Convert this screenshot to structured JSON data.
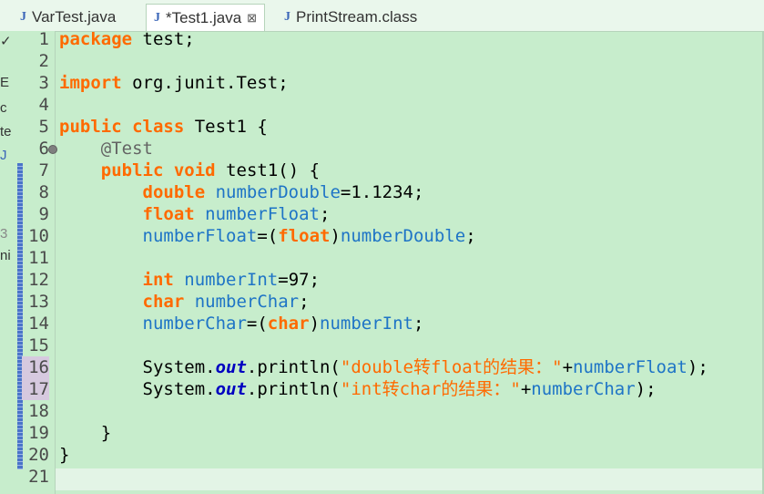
{
  "tabs": [
    {
      "label": "VarTest.java",
      "icon": "java-file-icon",
      "active": false
    },
    {
      "label": "*Test1.java",
      "icon": "java-file-icon",
      "active": true,
      "close": "⊠"
    },
    {
      "label": "PrintStream.class",
      "icon": "class-file-icon",
      "active": false
    }
  ],
  "left_strip": [
    "✓",
    "E",
    "c",
    "te",
    "J",
    "3",
    "ni"
  ],
  "editor": {
    "line_numbers": [
      "1",
      "2",
      "3",
      "4",
      "5",
      "6",
      "7",
      "8",
      "9",
      "10",
      "11",
      "12",
      "13",
      "14",
      "15",
      "16",
      "17",
      "18",
      "19",
      "20",
      "21"
    ],
    "lines": [
      [
        {
          "t": "package",
          "c": "kw"
        },
        {
          "t": " test;"
        }
      ],
      [],
      [
        {
          "t": "import",
          "c": "kw"
        },
        {
          "t": " org.junit.Test;"
        }
      ],
      [],
      [
        {
          "t": "public",
          "c": "kw"
        },
        {
          "t": " "
        },
        {
          "t": "class",
          "c": "kw"
        },
        {
          "t": " Test1 {"
        }
      ],
      [
        {
          "t": "    "
        },
        {
          "t": "@Test",
          "c": "ann"
        }
      ],
      [
        {
          "t": "    "
        },
        {
          "t": "public",
          "c": "kw"
        },
        {
          "t": " "
        },
        {
          "t": "void",
          "c": "kw"
        },
        {
          "t": " test1() {"
        }
      ],
      [
        {
          "t": "        "
        },
        {
          "t": "double",
          "c": "kw"
        },
        {
          "t": " "
        },
        {
          "t": "numberDouble",
          "c": "var"
        },
        {
          "t": "=1.1234;"
        }
      ],
      [
        {
          "t": "        "
        },
        {
          "t": "float",
          "c": "kw"
        },
        {
          "t": " "
        },
        {
          "t": "numberFloat",
          "c": "var"
        },
        {
          "t": ";"
        }
      ],
      [
        {
          "t": "        "
        },
        {
          "t": "numberFloat",
          "c": "var"
        },
        {
          "t": "=("
        },
        {
          "t": "float",
          "c": "kw"
        },
        {
          "t": ")"
        },
        {
          "t": "numberDouble",
          "c": "var"
        },
        {
          "t": ";"
        }
      ],
      [],
      [
        {
          "t": "        "
        },
        {
          "t": "int",
          "c": "kw"
        },
        {
          "t": " "
        },
        {
          "t": "numberInt",
          "c": "var"
        },
        {
          "t": "=97;"
        }
      ],
      [
        {
          "t": "        "
        },
        {
          "t": "char",
          "c": "kw"
        },
        {
          "t": " "
        },
        {
          "t": "numberChar",
          "c": "var"
        },
        {
          "t": ";"
        }
      ],
      [
        {
          "t": "        "
        },
        {
          "t": "numberChar",
          "c": "var"
        },
        {
          "t": "=("
        },
        {
          "t": "char",
          "c": "kw"
        },
        {
          "t": ")"
        },
        {
          "t": "numberInt",
          "c": "var"
        },
        {
          "t": ";"
        }
      ],
      [],
      [
        {
          "t": "        System."
        },
        {
          "t": "out",
          "c": "fld"
        },
        {
          "t": ".println("
        },
        {
          "t": "\"double转float的结果：\"",
          "c": "str"
        },
        {
          "t": "+"
        },
        {
          "t": "numberFloat",
          "c": "var"
        },
        {
          "t": ");"
        }
      ],
      [
        {
          "t": "        System."
        },
        {
          "t": "out",
          "c": "fld"
        },
        {
          "t": ".println("
        },
        {
          "t": "\"int转char的结果：\"",
          "c": "str"
        },
        {
          "t": "+"
        },
        {
          "t": "numberChar",
          "c": "var"
        },
        {
          "t": ");"
        }
      ],
      [],
      [
        {
          "t": "    }"
        }
      ],
      [
        {
          "t": "}"
        }
      ],
      []
    ]
  },
  "colors": {
    "background": "#c7edcc",
    "keyword": "#ff6a00",
    "variable": "#1e74c6",
    "annotation": "#646464",
    "static_field": "#0000c0"
  }
}
